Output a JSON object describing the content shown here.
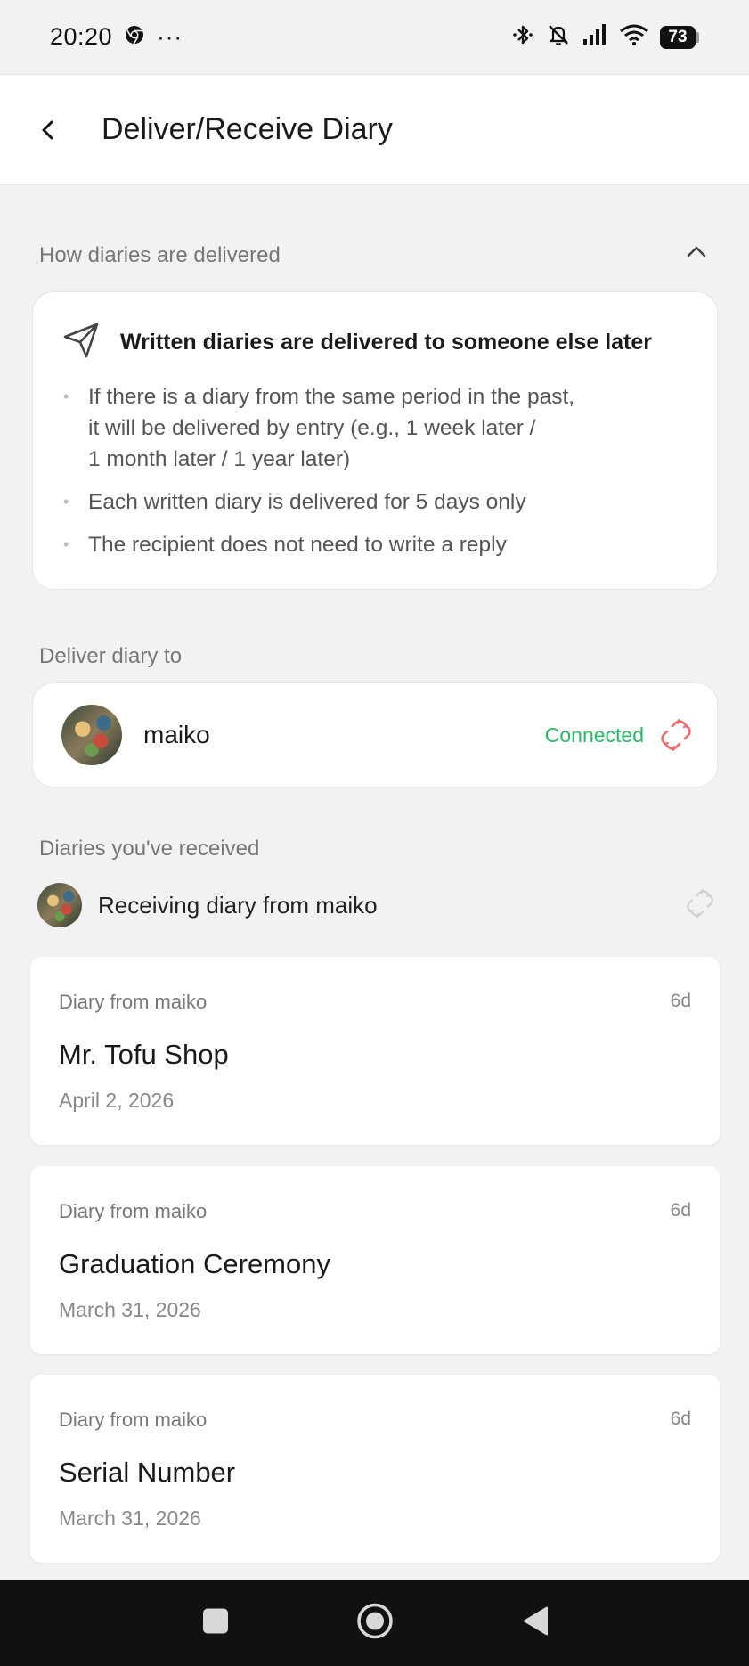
{
  "status_bar": {
    "time": "20:20",
    "more_indicator": "···",
    "battery": "73",
    "icons": [
      "chrome-icon",
      "bluetooth-icon",
      "bell-off-icon",
      "signal-icon",
      "wifi-icon",
      "battery-icon"
    ]
  },
  "header": {
    "title": "Deliver/Receive Diary"
  },
  "info": {
    "section_label": "How diaries are delivered",
    "title": "Written diaries are delivered to someone else later",
    "bullets": [
      "If there is a diary from the same period in the past, it will be delivered by entry (e.g., 1 week later / 1 month later / 1 year later)",
      "Each written diary is delivered for 5 days only",
      "The recipient does not need to write a reply"
    ],
    "bullet_lines_1": [
      "If there is a diary from the same period in the past,",
      "it will be delivered by entry (e.g., 1 week later /",
      "1 month later / 1 year later)"
    ]
  },
  "deliver": {
    "section_label": "Deliver diary to",
    "name": "maiko",
    "status": "Connected",
    "status_color": "#2bb866",
    "unlink_color": "#f06a6a"
  },
  "received": {
    "section_label": "Diaries you've received",
    "receiving_text": "Receiving diary from maiko",
    "diaries": [
      {
        "from": "Diary from maiko",
        "age": "6d",
        "title": "Mr. Tofu Shop",
        "date": "April 2, 2026"
      },
      {
        "from": "Diary from maiko",
        "age": "6d",
        "title": "Graduation Ceremony",
        "date": "March 31, 2026"
      },
      {
        "from": "Diary from maiko",
        "age": "6d",
        "title": "Serial Number",
        "date": "March 31, 2026"
      }
    ]
  }
}
